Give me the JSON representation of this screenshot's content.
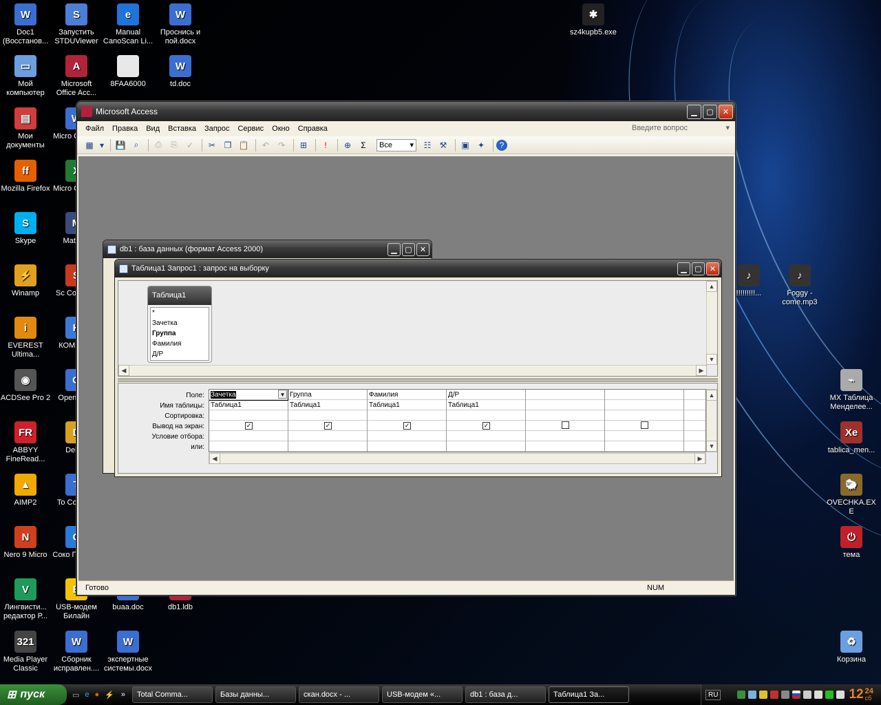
{
  "desktop_icons": [
    {
      "name": "Doc1 (Восстанов...",
      "icon": "word-doc-icon",
      "color": "#3a6fd1",
      "g": "W"
    },
    {
      "name": "Запустить STDUViewer",
      "icon": "stdu-viewer-icon",
      "color": "#4b7fd6",
      "g": "S"
    },
    {
      "name": "Manual CanoScan Li...",
      "icon": "ie-icon",
      "color": "#1f74d9",
      "g": "e"
    },
    {
      "name": "Проснись и пой.docx",
      "icon": "word-doc-icon",
      "color": "#3a6fd1",
      "g": "W"
    },
    {
      "name": "Мой компьютер",
      "icon": "my-computer-icon",
      "color": "#6c9fe0",
      "g": "▭"
    },
    {
      "name": "Microsoft Office Acc...",
      "icon": "access-icon",
      "color": "#b2223b",
      "g": "A"
    },
    {
      "name": "8FAA6000",
      "icon": "blank-file-icon",
      "color": "#e8e8e8",
      "g": ""
    },
    {
      "name": "td.doc",
      "icon": "word-doc-icon",
      "color": "#3a6fd1",
      "g": "W"
    },
    {
      "name": "Мои документы",
      "icon": "my-documents-icon",
      "color": "#d23c3c",
      "g": "▤"
    },
    {
      "name": "Micro Office...",
      "icon": "office-icon",
      "color": "#3a6fd1",
      "g": "W"
    },
    {
      "name": "Mozilla Firefox",
      "icon": "firefox-icon",
      "color": "#e66000",
      "g": "ff"
    },
    {
      "name": "Micro Office...",
      "icon": "excel-icon",
      "color": "#1f7a32",
      "g": "X"
    },
    {
      "name": "Skype",
      "icon": "skype-icon",
      "color": "#00aff0",
      "g": "S"
    },
    {
      "name": "Mathc...",
      "icon": "mathcad-icon",
      "color": "#3a4a7a",
      "g": "M"
    },
    {
      "name": "Winamp",
      "icon": "winamp-icon",
      "color": "#e0a020",
      "g": "⚡"
    },
    {
      "name": "Sc Conver...",
      "icon": "converter-icon",
      "color": "#c83a1e",
      "g": "S"
    },
    {
      "name": "EVEREST Ultima...",
      "icon": "everest-icon",
      "color": "#e08a10",
      "g": "i"
    },
    {
      "name": "КОМП... V",
      "icon": "kompas-icon",
      "color": "#3a7ad6",
      "g": "K"
    },
    {
      "name": "ACDSee Pro 2",
      "icon": "acdsee-icon",
      "color": "#555",
      "g": "◉"
    },
    {
      "name": "OpenC... 3",
      "icon": "openoffice-icon",
      "color": "#3a6fd1",
      "g": "O"
    },
    {
      "name": "ABBYY FineRead...",
      "icon": "abbyy-icon",
      "color": "#d0202a",
      "g": "FR"
    },
    {
      "name": "Delp...",
      "icon": "delphi-icon",
      "color": "#d8a020",
      "g": "D"
    },
    {
      "name": "AIMP2",
      "icon": "aimp-icon",
      "color": "#f2a900",
      "g": "▲"
    },
    {
      "name": "To Comm...",
      "icon": "total-commander-icon",
      "color": "#3a6fd1",
      "g": "T"
    },
    {
      "name": "Nero 9 Micro",
      "icon": "nero-icon",
      "color": "#d04020",
      "g": "N"
    },
    {
      "name": "Соко Персо...",
      "icon": "app-icon",
      "color": "#2a7ad8",
      "g": "C"
    },
    {
      "name": "Лингвисти... редактор Р...",
      "icon": "lingvo-icon",
      "color": "#1f9a5a",
      "g": "V"
    },
    {
      "name": "USB-модем Билайн",
      "icon": "usb-modem-icon",
      "color": "#f2c400",
      "g": "B"
    },
    {
      "name": "buaa.doc",
      "icon": "word-doc-icon",
      "color": "#3a6fd1",
      "g": "W"
    },
    {
      "name": "db1.ldb",
      "icon": "ldb-file-icon",
      "color": "#b2223b",
      "g": "A"
    },
    {
      "name": "Media Player Classic",
      "icon": "mpc-icon",
      "color": "#444",
      "g": "321"
    },
    {
      "name": "Сборник исправлен....",
      "icon": "word-doc-icon",
      "color": "#3a6fd1",
      "g": "W"
    },
    {
      "name": "экспертные системы.docx",
      "icon": "word-doc-icon",
      "color": "#3a6fd1",
      "g": "W"
    },
    {
      "name": "sz4kupb5.exe",
      "icon": "spider-exe-icon",
      "color": "#222",
      "g": "✱"
    },
    {
      "name": "!!!!!!!!!...",
      "icon": "music-note-icon",
      "color": "#333",
      "g": "♪"
    },
    {
      "name": "Foggy - come.mp3",
      "icon": "mp3-file-icon",
      "color": "#333",
      "g": "♪"
    },
    {
      "name": "MX Таблица Менделее...",
      "icon": "mx-table-icon",
      "color": "#aaa",
      "g": "⌁"
    },
    {
      "name": "tablica_men...",
      "icon": "image-file-icon",
      "color": "#a0302a",
      "g": "Xe"
    },
    {
      "name": "OVECHKA.EXE",
      "icon": "sheep-exe-icon",
      "color": "#8a6a2a",
      "g": "🐑"
    },
    {
      "name": "тема",
      "icon": "theme-icon",
      "color": "#c0202a",
      "g": "⏻"
    },
    {
      "name": "Корзина",
      "icon": "recycle-bin-icon",
      "color": "#6aa0e0",
      "g": "♻"
    }
  ],
  "access": {
    "title": "Microsoft Access",
    "menu": [
      "Файл",
      "Правка",
      "Вид",
      "Вставка",
      "Запрос",
      "Сервис",
      "Окно",
      "Справка"
    ],
    "ask_placeholder": "Введите вопрос",
    "toolbar_combo": "Все",
    "status_left": "Готово",
    "status_right": "NUM"
  },
  "db_window": {
    "title": "db1 : база данных (формат Access 2000)"
  },
  "query_window": {
    "title": "Таблица1 Запрос1 : запрос на выборку",
    "field_list": {
      "title": "Таблица1",
      "fields": [
        "*",
        "Зачетка",
        "Группа",
        "Фамилия",
        "Д/Р"
      ]
    },
    "row_labels": [
      "Поле:",
      "Имя таблицы:",
      "Сортировка:",
      "Вывод на экран:",
      "Условие отбора:",
      "или:"
    ],
    "columns": [
      {
        "field": "Зачетка",
        "table": "Таблица1",
        "show": true
      },
      {
        "field": "Группа",
        "table": "Таблица1",
        "show": true
      },
      {
        "field": "Фамилия",
        "table": "Таблица1",
        "show": true
      },
      {
        "field": "Д/Р",
        "table": "Таблица1",
        "show": true
      },
      {
        "field": "",
        "table": "",
        "show": false
      },
      {
        "field": "",
        "table": "",
        "show": false
      },
      {
        "field": "",
        "table": "",
        "show": null
      }
    ]
  },
  "taskbar": {
    "start_label": "пуск",
    "buttons": [
      "Total Comma...",
      "Базы данны...",
      "скан.docx - ...",
      "USB-модем «...",
      "db1 : база д...",
      "Таблица1 За..."
    ],
    "lang": "RU",
    "time": "12",
    "time_min": "24",
    "day": "сб"
  }
}
